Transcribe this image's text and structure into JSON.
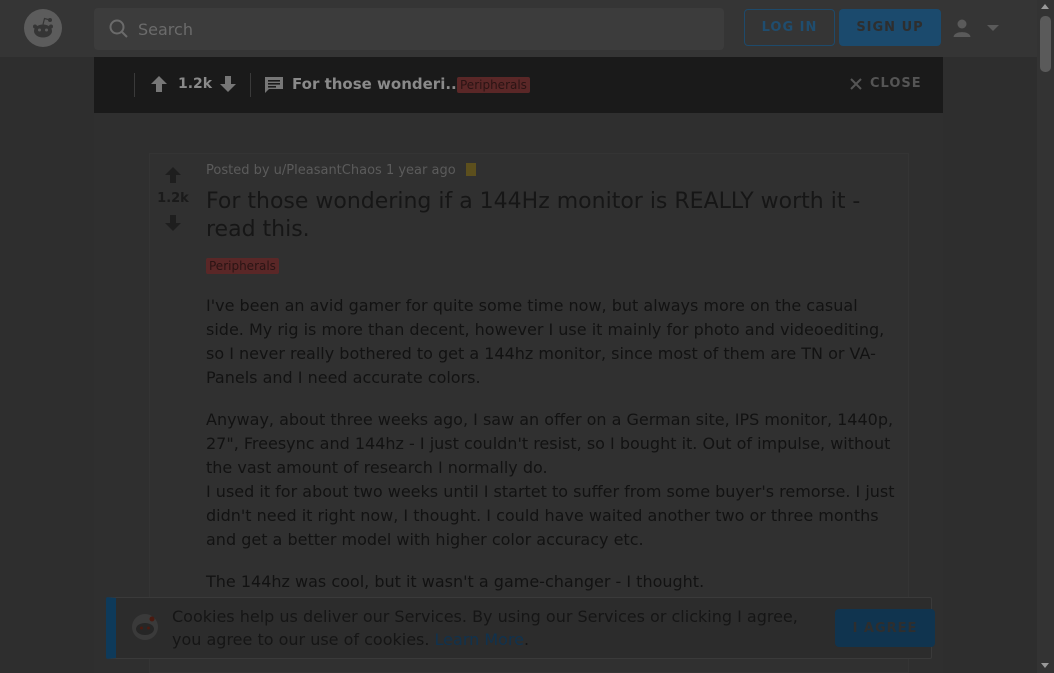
{
  "header": {
    "search_placeholder": "Search",
    "login_label": "LOG IN",
    "signup_label": "SIGN UP"
  },
  "post_bar": {
    "score": "1.2k",
    "title_truncated": "For those wonderi...",
    "flair": "Peripherals",
    "close_label": "CLOSE"
  },
  "post": {
    "meta_prefix": "Posted by",
    "author": "u/PleasantChaos",
    "time": "1 year ago",
    "score": "1.2k",
    "title": "For those wondering if a 144Hz monitor is REALLY worth it - read this.",
    "flair": "Peripherals",
    "paragraphs": [
      "I've been an avid gamer for quite some time now, but always more on the casual side. My rig is more than decent, however I use it mainly for photo and videoediting, so I never really bothered to get a 144hz monitor, since most of them are TN or VA-Panels and I need accurate colors.",
      "Anyway, about three weeks ago, I saw an offer on a German site, IPS monitor, 1440p, 27\", Freesync and 144hz - I just couldn't resist, so I bought it. Out of impulse, without the vast amount of research I normally do.",
      "I used it for about two weeks until I startet to suffer from some buyer's remorse. I just didn't need it right now, I thought. I could have waited another two or three months and get a better model with higher color accuracy etc.",
      "The 144hz was cool, but it wasn't a game-changer - I thought."
    ]
  },
  "cookie": {
    "text": "Cookies help us deliver our Services. By using our Services or clicking I agree, you agree to our use of cookies.",
    "learn_more": "Learn More",
    "period": ".",
    "agree_label": "I AGREE"
  },
  "colors": {
    "overlay_bg": "#2e2e2e",
    "bar_bg": "#1a1a1a",
    "flair_bg": "#5a2727",
    "signup_bg": "#1b4a6d"
  }
}
